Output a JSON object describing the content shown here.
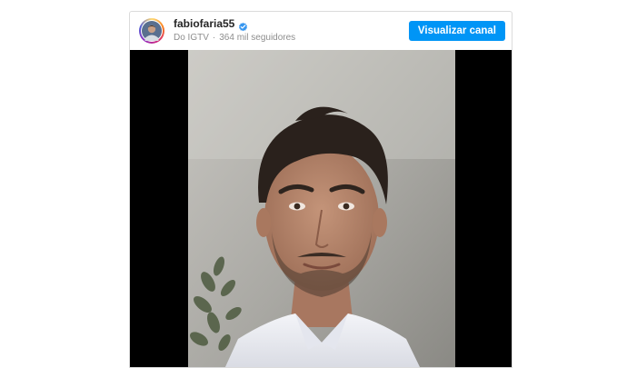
{
  "profile": {
    "username": "fabiofaria55",
    "verified": true,
    "source": "Do IGTV",
    "separator": "·",
    "followers": "364 mil seguidores"
  },
  "actions": {
    "view_channel_label": "Visualizar canal"
  },
  "colors": {
    "button_bg": "#0095f6",
    "verified_badge": "#3897f0",
    "video_letterbox": "#000000"
  },
  "icons": {
    "verified": "verified-badge-icon",
    "avatar": "profile-avatar"
  },
  "video": {
    "content": "man-speaking-to-camera"
  }
}
